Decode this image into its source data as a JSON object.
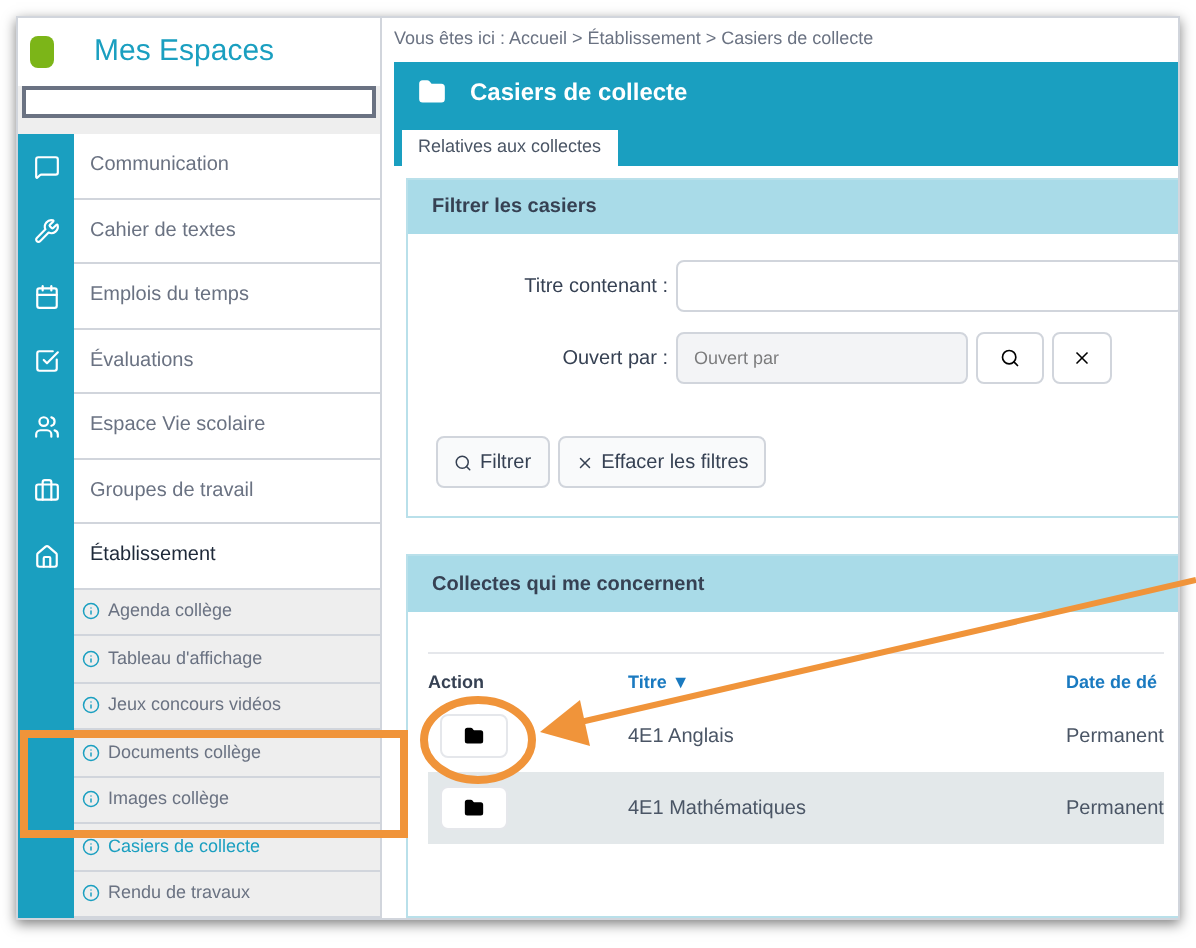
{
  "sidebar": {
    "title": "Mes Espaces",
    "items": [
      {
        "label": "Communication",
        "selected": false
      },
      {
        "label": "Cahier de textes",
        "selected": false
      },
      {
        "label": "Emplois du temps",
        "selected": false
      },
      {
        "label": "Évaluations",
        "selected": false
      },
      {
        "label": "Espace Vie scolaire",
        "selected": false
      },
      {
        "label": "Groupes de travail",
        "selected": false
      },
      {
        "label": "Établissement",
        "selected": true,
        "children": [
          {
            "label": "Agenda collège",
            "selected": false
          },
          {
            "label": "Tableau d'affichage",
            "selected": false
          },
          {
            "label": "Jeux concours vidéos",
            "selected": false
          },
          {
            "label": "Documents collège",
            "selected": false
          },
          {
            "label": "Images collège",
            "selected": false
          },
          {
            "label": "Casiers de collecte",
            "selected": true
          },
          {
            "label": "Rendu de travaux",
            "selected": false
          }
        ]
      }
    ]
  },
  "breadcrumb": "Vous êtes ici : Accueil > Établissement > Casiers de collecte",
  "header": {
    "title": "Casiers de collecte"
  },
  "tabs": [
    {
      "label": "Relatives aux collectes",
      "selected": true
    }
  ],
  "filter": {
    "title": "Filtrer les casiers",
    "fields": [
      {
        "label": "Titre contenant :"
      },
      {
        "label": "Ouvert par :",
        "placeholder": "Ouvert par"
      }
    ],
    "buttons": [
      "Filtrer",
      "Effacer les filtres"
    ]
  },
  "collections": {
    "title": "Collectes qui me concernent",
    "columns": [
      "Action",
      "Titre ▼",
      "Date de dé"
    ],
    "rows": [
      {
        "title": "4E1 Anglais",
        "date": "Permanent"
      },
      {
        "title": "4E1 Mathématiques",
        "date": "Permanent"
      }
    ]
  }
}
